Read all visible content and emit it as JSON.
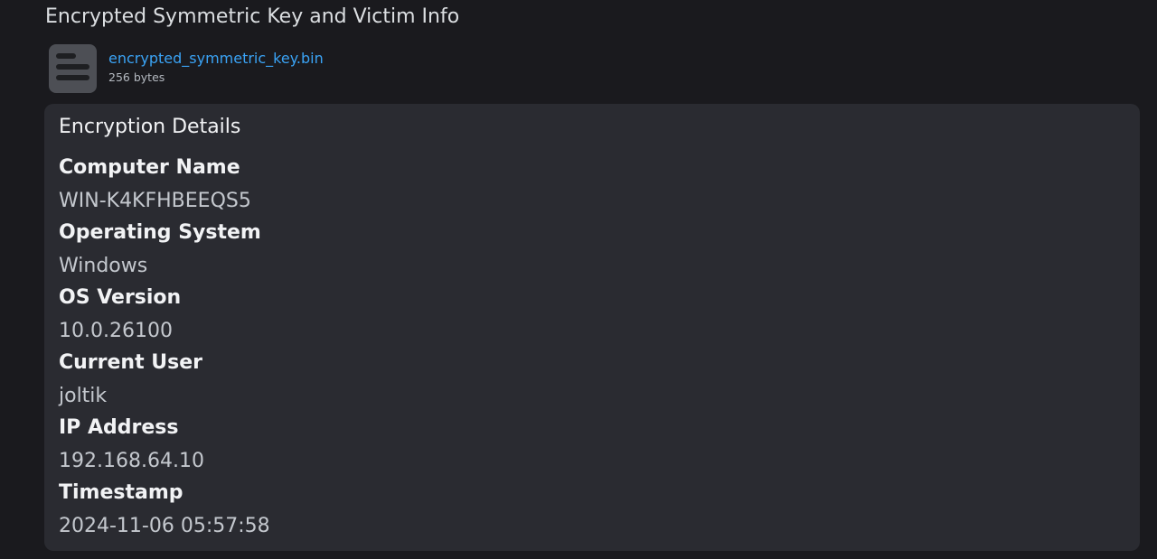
{
  "message": {
    "text": "Encrypted Symmetric Key and Victim Info"
  },
  "attachment": {
    "icon": "file-text-icon",
    "file_name": "encrypted_symmetric_key.bin",
    "file_size": "256 bytes"
  },
  "embed": {
    "title": "Encryption Details",
    "fields": [
      {
        "name": "Computer Name",
        "value": "WIN-K4KFHBEEQS5"
      },
      {
        "name": "Operating System",
        "value": "Windows"
      },
      {
        "name": "OS Version",
        "value": "10.0.26100"
      },
      {
        "name": "Current User",
        "value": "joltik"
      },
      {
        "name": "IP Address",
        "value": "192.168.64.10"
      },
      {
        "name": "Timestamp",
        "value": "2024-11-06 05:57:58"
      }
    ]
  },
  "colors": {
    "background": "#1a1a1e",
    "embed_background": "#2a2b31",
    "link": "#3aa3f5",
    "text": "#dbdee1"
  }
}
